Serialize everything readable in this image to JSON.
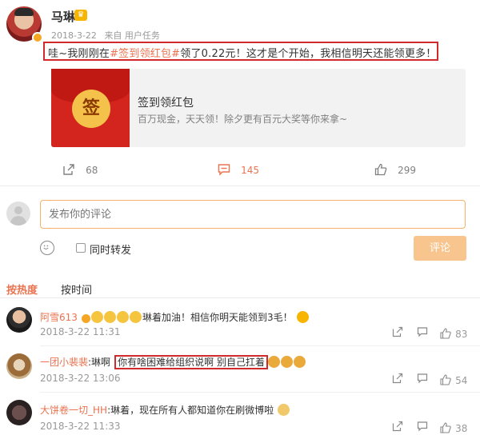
{
  "post": {
    "author": "马琳",
    "date": "2018-3-22",
    "source": "来自 用户任务",
    "text_prefix": "哇~我刚刚在",
    "text_tag": "#签到领红包#",
    "text_suffix": "领了0.22元！这才是个开始，我相信明天还能领更多！"
  },
  "card": {
    "icon_char": "签",
    "title": "签到领红包",
    "description": "百万现金，天天领！除夕更有百元大奖等你来拿~"
  },
  "actions": {
    "share_count": "68",
    "comment_count": "145",
    "like_count": "299"
  },
  "compose": {
    "placeholder": "发布你的评论",
    "repost_label": "同时转发",
    "submit_label": "评论"
  },
  "tabs": {
    "hot": "按热度",
    "time": "按时间"
  },
  "comments": [
    {
      "name": "阿雪613",
      "text": "琳着加油！相信你明天能领到3毛！",
      "time": "2018-3-22 11:31",
      "likes": "83"
    },
    {
      "name": "一团小裴裴",
      "text_prefix": ":琳啊",
      "text_highlight": "你有啥困难给组织说啊 别自己扛着",
      "time": "2018-3-22 13:06",
      "likes": "54"
    },
    {
      "name": "大饼卷一切_HH",
      "text": ":琳着，现在所有人都知道你在刷微博啦",
      "time": "2018-3-22 11:33",
      "likes": "38"
    }
  ],
  "colors": {
    "accent": "#eb7350",
    "highlight_border": "#d12a2a",
    "card_red": "#d3241d"
  }
}
